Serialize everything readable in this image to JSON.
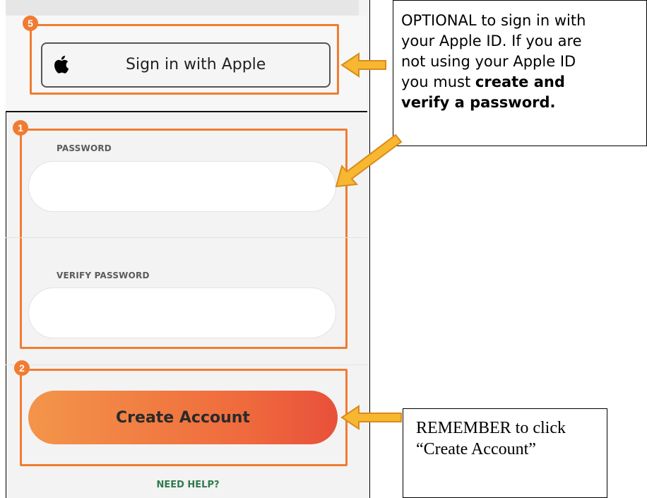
{
  "apple_signin": {
    "badge": "5",
    "button_label": "Sign in with Apple"
  },
  "password_section": {
    "badge": "1",
    "password_label": "PASSWORD",
    "verify_label": "VERIFY PASSWORD",
    "password_value": "",
    "verify_value": ""
  },
  "create_section": {
    "badge": "2",
    "button_label": "Create Account",
    "help_link": "NEED HELP?"
  },
  "callouts": {
    "top": {
      "line1": "OPTIONAL to sign in with",
      "line2": "your Apple ID.  If you are",
      "line3": "not using your Apple ID",
      "line4_prefix": "you must ",
      "line4_bold": "create and",
      "line5_bold": "verify a password."
    },
    "bottom": {
      "text": "REMEMBER to click “Create Account”"
    }
  },
  "colors": {
    "accent_orange": "#f07c32",
    "arrow_fill": "#f7b731",
    "help_green": "#2f7a4e"
  }
}
